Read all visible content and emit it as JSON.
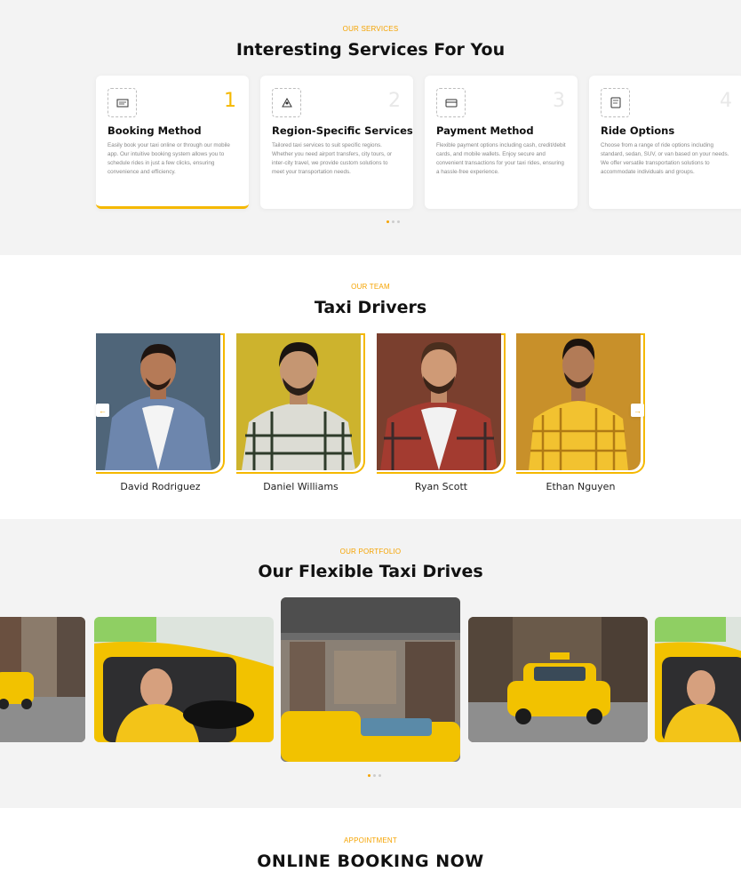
{
  "services": {
    "eyebrow": "OUR SERVICES",
    "title": "Interesting Services For You",
    "cards": [
      {
        "number": "1",
        "icon": "booking-icon",
        "title": "Booking Method",
        "desc": "Easily book your taxi online or through our mobile app. Our intuitive booking system allows you to schedule rides in just a few clicks, ensuring convenience and efficiency."
      },
      {
        "number": "2",
        "icon": "region-icon",
        "title": "Region-Specific Services",
        "desc": "Tailored taxi services to suit specific regions. Whether you need airport transfers, city tours, or inter-city travel, we provide custom solutions to meet your transportation needs."
      },
      {
        "number": "3",
        "icon": "payment-icon",
        "title": "Payment Method",
        "desc": "Flexible payment options including cash, credit/debit cards, and mobile wallets. Enjoy secure and convenient transactions for your taxi rides, ensuring a hassle-free experience."
      },
      {
        "number": "4",
        "icon": "ride-options-icon",
        "title": "Ride Options",
        "desc": "Choose from a range of ride options including standard, sedan, SUV, or van based on your needs. We offer versatile transportation solutions to accommodate individuals and groups."
      }
    ]
  },
  "team": {
    "eyebrow": "OUR TEAM",
    "title": "Taxi Drivers",
    "prev_icon": "arrow-left-icon",
    "next_icon": "arrow-right-icon",
    "drivers": [
      {
        "name": "David Rodriguez",
        "bg": "#4f6579"
      },
      {
        "name": "Daniel Williams",
        "bg": "#cdb32d"
      },
      {
        "name": "Ryan Scott",
        "bg": "#7a3f2e"
      },
      {
        "name": "Ethan Nguyen",
        "bg": "#c8902a"
      }
    ]
  },
  "portfolio": {
    "eyebrow": "OUR PORTFOLIO",
    "title": "Our Flexible Taxi Drives"
  },
  "appointment": {
    "eyebrow": "APPOINTMENT",
    "title": "ONLINE BOOKING NOW"
  },
  "colors": {
    "accent": "#f5a300",
    "taxi_yellow": "#f2c200",
    "section_gray": "#f3f3f3"
  }
}
